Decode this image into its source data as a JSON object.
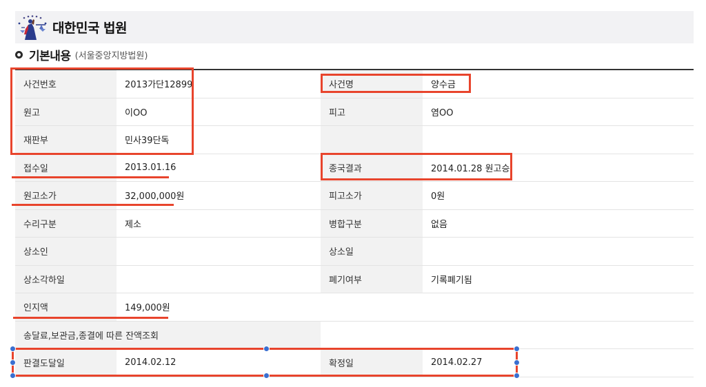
{
  "header": {
    "court_name": "대한민국 법원"
  },
  "section": {
    "title": "기본내용",
    "subtitle": "(서울중앙지방법원)"
  },
  "rows": [
    {
      "l1": "사건번호",
      "v1": "2013가단12899",
      "l2": "사건명",
      "v2": "양수금"
    },
    {
      "l1": "원고",
      "v1": "이OO",
      "l2": "피고",
      "v2": "염OO"
    },
    {
      "l1": "재판부",
      "v1": "민사39단독",
      "l2": "",
      "v2": ""
    },
    {
      "l1": "접수일",
      "v1": "2013.01.16",
      "l2": "종국결과",
      "v2": "2014.01.28 원고승"
    },
    {
      "l1": "원고소가",
      "v1": "32,000,000원",
      "l2": "피고소가",
      "v2": "0원"
    },
    {
      "l1": "수리구분",
      "v1": "제소",
      "l2": "병합구분",
      "v2": "없음"
    },
    {
      "l1": "상소인",
      "v1": "",
      "l2": "상소일",
      "v2": ""
    },
    {
      "l1": "상소각하일",
      "v1": "",
      "l2": "폐기여부",
      "v2": "기록폐기됨"
    },
    {
      "l1": "인지액",
      "v1": "149,000원",
      "l2": "",
      "v2": ""
    },
    {
      "l1": "송달료,보관금,종결에 따른 잔액조회",
      "v1": "",
      "l2": "",
      "v2": ""
    },
    {
      "l1": "판결도달일",
      "v1": "2014.02.12",
      "l2": "확정일",
      "v2": "2014.02.27"
    }
  ],
  "colors": {
    "annotation_red": "#e8442c",
    "handle_blue": "#3a6fd0",
    "label_bg": "#f2f2f2",
    "header_bg": "#f2f2f4"
  }
}
